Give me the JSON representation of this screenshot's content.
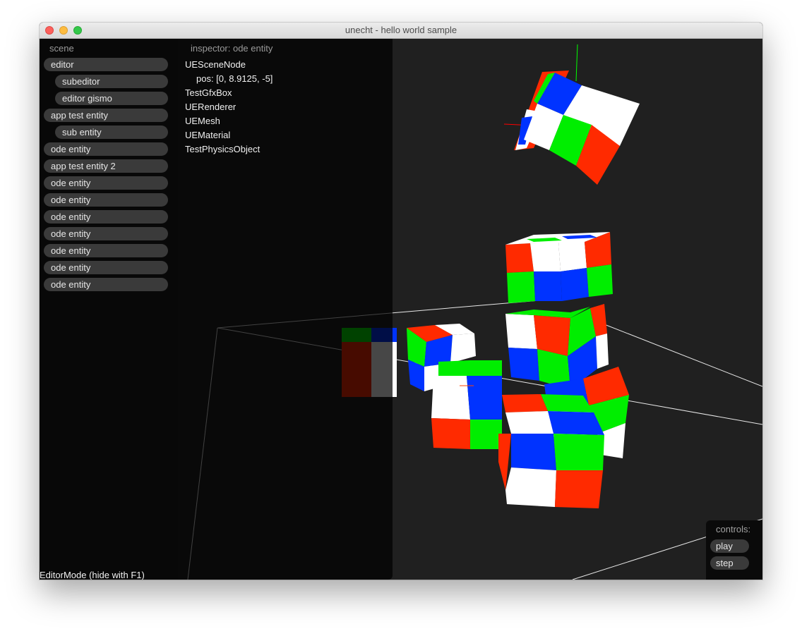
{
  "window": {
    "title": "unecht - hello world sample"
  },
  "scene": {
    "header": "scene",
    "items": [
      {
        "label": "editor",
        "indent": 0
      },
      {
        "label": "subeditor",
        "indent": 1
      },
      {
        "label": "editor gismo",
        "indent": 1
      },
      {
        "label": "app test entity",
        "indent": 0
      },
      {
        "label": "sub entity",
        "indent": 1
      },
      {
        "label": "ode entity",
        "indent": 0
      },
      {
        "label": "app test entity 2",
        "indent": 0
      },
      {
        "label": "ode entity",
        "indent": 0
      },
      {
        "label": "ode entity",
        "indent": 0
      },
      {
        "label": "ode entity",
        "indent": 0
      },
      {
        "label": "ode entity",
        "indent": 0
      },
      {
        "label": "ode entity",
        "indent": 0
      },
      {
        "label": "ode entity",
        "indent": 0
      },
      {
        "label": "ode entity",
        "indent": 0
      }
    ]
  },
  "inspector": {
    "header": "inspector: ode entity",
    "components": [
      {
        "label": "UESceneNode",
        "indent": 0
      },
      {
        "label": "pos: [0, 8.9125, -5]",
        "indent": 1
      },
      {
        "label": "TestGfxBox",
        "indent": 0
      },
      {
        "label": "UERenderer",
        "indent": 0
      },
      {
        "label": "UEMesh",
        "indent": 0
      },
      {
        "label": "UEMaterial",
        "indent": 0
      },
      {
        "label": "TestPhysicsObject",
        "indent": 0
      }
    ]
  },
  "controls": {
    "header": "controls:",
    "play_label": "play",
    "step_label": "step"
  },
  "status": {
    "mode_label": "EditorMode (hide with F1)"
  },
  "colors": {
    "red": "#ff2a00",
    "green": "#00ee00",
    "blue": "#0033ff",
    "white": "#ffffff",
    "background": "#202020",
    "panel": "#080808",
    "button": "#3a3a3a"
  },
  "icons": [
    "close-traffic-light",
    "minimize-traffic-light",
    "maximize-traffic-light"
  ]
}
